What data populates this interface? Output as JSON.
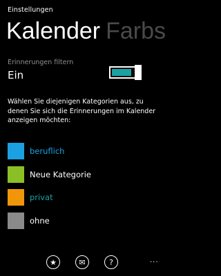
{
  "app_title": "Einstellungen",
  "pivot": {
    "active": "Kalender",
    "next": "Farbs"
  },
  "filter": {
    "label": "Erinnerungen filtern",
    "value": "Ein",
    "toggle_on": true,
    "toggle_color": "#1ba1a1"
  },
  "description": "Wählen Sie diejenigen Kategorien aus, zu denen Sie sich die Erinnerungen im Kalender anzeigen möchten:",
  "categories": [
    {
      "label": "beruflich",
      "color": "#1ba1e2",
      "label_color": "#1ba1e2"
    },
    {
      "label": "Neue Kategorie",
      "color": "#8cbf26",
      "label_color": "#ffffff"
    },
    {
      "label": "privat",
      "color": "#f09609",
      "label_color": "#1ba1a1"
    },
    {
      "label": "ohne",
      "color": "#8a8a8a",
      "label_color": "#ffffff"
    }
  ],
  "appbar": {
    "buttons": [
      {
        "icon": "favorite-star-icon",
        "glyph": "★"
      },
      {
        "icon": "mail-icon",
        "glyph": "✉"
      },
      {
        "icon": "help-icon",
        "glyph": "?"
      }
    ],
    "more": "..."
  }
}
